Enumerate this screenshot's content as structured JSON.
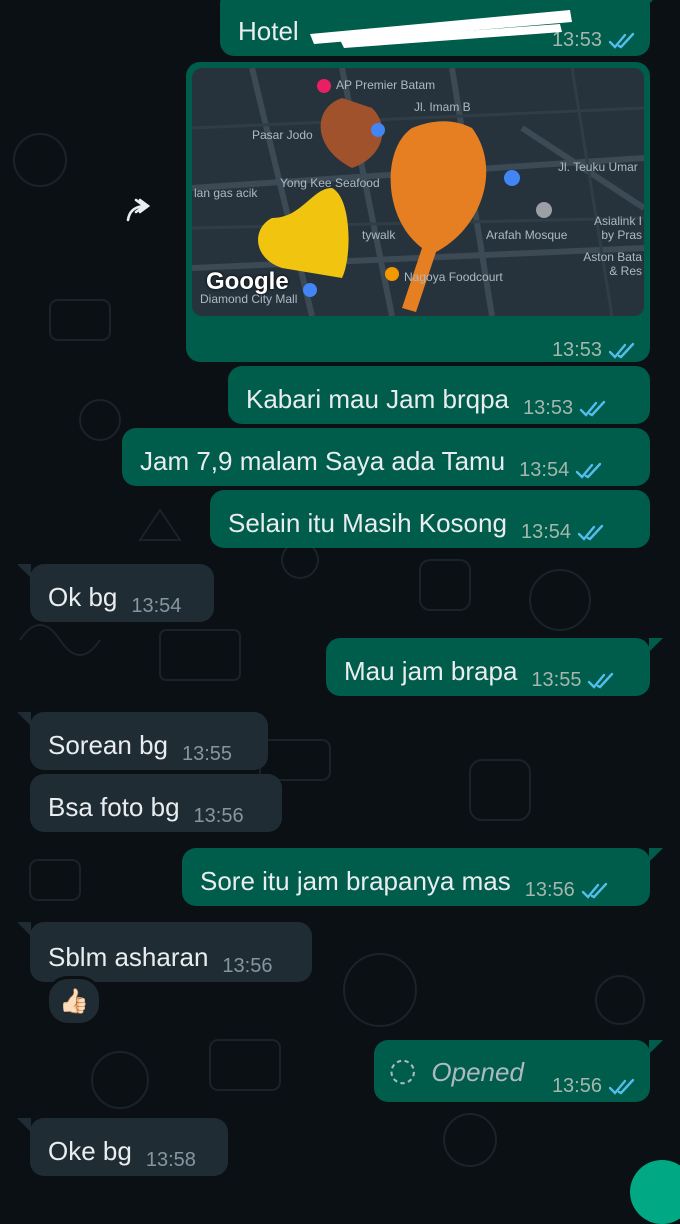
{
  "colors": {
    "background": "#0b1014",
    "outgoing_bubble": "#005c4b",
    "incoming_bubble": "#1f2c34",
    "read_ticks": "#53bdeb",
    "fab": "#00a884"
  },
  "messages": [
    {
      "id": "m0",
      "direction": "outgoing",
      "text": "Hotel",
      "time": "13:53",
      "status": "read",
      "redacted": true,
      "partial": true
    },
    {
      "id": "m1",
      "direction": "outgoing",
      "type": "location",
      "forwardable": true,
      "time": "13:53",
      "status": "read",
      "map": {
        "labels": [
          "AP Premier Batam",
          "Jl. Imam B",
          "Pasar Jodo",
          "Yong Kee Seafood",
          "lan gas acik",
          "Jl. Teuku Umar",
          "Asialink I by Pras",
          "Arafah Mosque",
          "Aston Bata & Res",
          "Nagoya Foodcourt",
          "tywalk",
          "Diamond City Mall"
        ],
        "brand": "Google",
        "sticker": "autumn-leaves"
      }
    },
    {
      "id": "m2",
      "direction": "outgoing",
      "text": "Kabari mau Jam brqpa",
      "time": "13:53",
      "status": "read"
    },
    {
      "id": "m3",
      "direction": "outgoing",
      "text": "Jam 7,9 malam Saya ada Tamu",
      "time": "13:54",
      "status": "read"
    },
    {
      "id": "m4",
      "direction": "outgoing",
      "text": "Selain itu Masih Kosong",
      "time": "13:54",
      "status": "read"
    },
    {
      "id": "m5",
      "direction": "incoming",
      "text": "Ok bg",
      "time": "13:54"
    },
    {
      "id": "m6",
      "direction": "outgoing",
      "text": "Mau jam brapa",
      "time": "13:55",
      "status": "read"
    },
    {
      "id": "m7",
      "direction": "incoming",
      "text": "Sorean bg",
      "time": "13:55"
    },
    {
      "id": "m8",
      "direction": "incoming",
      "text": "Bsa foto bg",
      "time": "13:56"
    },
    {
      "id": "m9",
      "direction": "outgoing",
      "text": "Sore itu jam brapanya mas",
      "time": "13:56",
      "status": "read"
    },
    {
      "id": "m10",
      "direction": "incoming",
      "text": "Sblm asharan",
      "time": "13:56",
      "reaction": "👍🏻"
    },
    {
      "id": "m11",
      "direction": "outgoing",
      "type": "view-once",
      "text": "Opened",
      "time": "13:56",
      "status": "read"
    },
    {
      "id": "m12",
      "direction": "incoming",
      "text": "Oke bg",
      "time": "13:58"
    }
  ]
}
